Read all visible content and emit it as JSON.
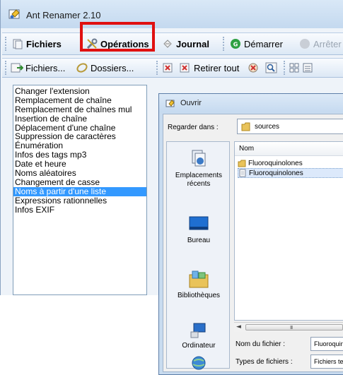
{
  "app": {
    "title": "Ant Renamer 2.10"
  },
  "tabs": [
    {
      "label": "Fichiers",
      "icon": "files-icon"
    },
    {
      "label": "Opérations",
      "icon": "tools-icon",
      "highlighted": true
    },
    {
      "label": "Journal",
      "icon": "journal-icon"
    },
    {
      "label": "Démarrer",
      "icon": "go-icon"
    },
    {
      "label": "Arrêter",
      "icon": "stop-icon",
      "disabled": true
    }
  ],
  "actions": [
    {
      "label": "Fichiers...",
      "icon": "add-files-icon"
    },
    {
      "label": "Dossiers...",
      "icon": "add-folders-icon"
    },
    {
      "label": "",
      "icon": "remove-icon"
    },
    {
      "label": "Retirer tout",
      "icon": "remove-all-icon"
    },
    {
      "label": "",
      "icon": "remove-dead-icon"
    },
    {
      "label": "",
      "icon": "search-icon"
    },
    {
      "label": "",
      "icon": "view-icon"
    }
  ],
  "operations": [
    "Changer l'extension",
    "Remplacement de chaîne",
    "Remplacement de chaînes mul",
    "Insertion de chaîne",
    "Déplacement d'une chaîne",
    "Suppression de caractères",
    "Énumération",
    "Infos des tags mp3",
    "Date et heure",
    "Noms aléatoires",
    "Changement de casse",
    "Noms à partir d'une liste",
    "Expressions rationnelles",
    "Infos EXIF"
  ],
  "selected_operation_index": 11,
  "dialog": {
    "title": "Ouvrir",
    "look_in_label": "Regarder dans :",
    "look_in_value": "sources",
    "places": [
      {
        "label": "Emplacements récents",
        "icon": "recent-places-icon"
      },
      {
        "label": "Bureau",
        "icon": "desktop-icon"
      },
      {
        "label": "Bibliothèques",
        "icon": "libraries-icon"
      },
      {
        "label": "Ordinateur",
        "icon": "computer-icon"
      },
      {
        "label": "",
        "icon": "network-icon"
      }
    ],
    "column_name": "Nom",
    "files": [
      {
        "name": "Fluoroquinolones",
        "type": "folder"
      },
      {
        "name": "Fluoroquinolones",
        "type": "text-file",
        "selected": true
      }
    ],
    "scroll_grip": "III",
    "filename_label": "Nom du fichier :",
    "filename_value": "Fluoroquinolones",
    "filetype_label": "Types de fichiers :",
    "filetype_value": "Fichiers texte"
  },
  "colors": {
    "highlight_box": "#e01010",
    "selection": "#3399ff"
  }
}
